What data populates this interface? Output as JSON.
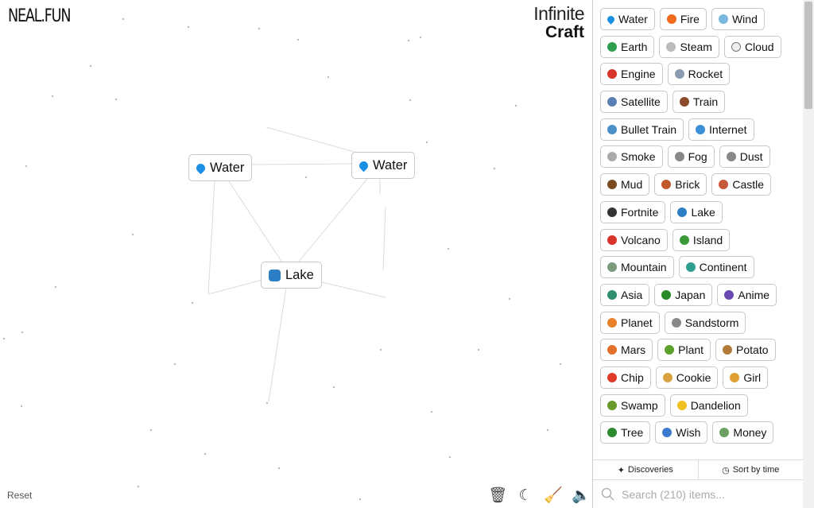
{
  "header": {
    "logo": "NEAL.FUN",
    "title_line1": "Infinite",
    "title_line2": "Craft"
  },
  "canvas": {
    "nodes": [
      {
        "label": "Water",
        "icon": "water-drop-icon",
        "color": "#1a8fe3"
      },
      {
        "label": "Water",
        "icon": "water-drop-icon",
        "color": "#1a8fe3"
      },
      {
        "label": "Lake",
        "icon": "wave-icon",
        "color": "#2c7fc4"
      }
    ],
    "reset_label": "Reset",
    "tools": [
      {
        "name": "trash-icon",
        "glyph": "🗑"
      },
      {
        "name": "moon-icon",
        "glyph": "☾"
      },
      {
        "name": "broom-icon",
        "glyph": "🧹"
      },
      {
        "name": "sound-icon",
        "glyph": "🔈"
      }
    ]
  },
  "sidebar": {
    "items": [
      {
        "label": "Water",
        "icon": "water-drop-icon",
        "color": "#1a8fe3"
      },
      {
        "label": "Fire",
        "icon": "fire-icon",
        "color": "#f26b1d"
      },
      {
        "label": "Wind",
        "icon": "wind-icon",
        "color": "#7bb8e0"
      },
      {
        "label": "Earth",
        "icon": "earth-icon",
        "color": "#2e9e4f"
      },
      {
        "label": "Steam",
        "icon": "steam-icon",
        "color": "#bbbbbb"
      },
      {
        "label": "Cloud",
        "icon": "cloud-icon",
        "color": "#eeeeee"
      },
      {
        "label": "Engine",
        "icon": "car-icon",
        "color": "#d9342b"
      },
      {
        "label": "Rocket",
        "icon": "rocket-icon",
        "color": "#8a9bb0"
      },
      {
        "label": "Satellite",
        "icon": "satellite-icon",
        "color": "#5a7fb5"
      },
      {
        "label": "Train",
        "icon": "train-icon",
        "color": "#8b4a2b"
      },
      {
        "label": "Bullet Train",
        "icon": "bullet-train-icon",
        "color": "#4a90c8"
      },
      {
        "label": "Internet",
        "icon": "globe-icon",
        "color": "#3a8fd6"
      },
      {
        "label": "Smoke",
        "icon": "smoke-icon",
        "color": "#aaaaaa"
      },
      {
        "label": "Fog",
        "icon": "fog-icon",
        "color": "#888888"
      },
      {
        "label": "Dust",
        "icon": "dust-icon",
        "color": "#888888"
      },
      {
        "label": "Mud",
        "icon": "mud-icon",
        "color": "#7a4a22"
      },
      {
        "label": "Brick",
        "icon": "brick-icon",
        "color": "#c0582a"
      },
      {
        "label": "Castle",
        "icon": "castle-icon",
        "color": "#c75a3a"
      },
      {
        "label": "Fortnite",
        "icon": "gamepad-icon",
        "color": "#333333"
      },
      {
        "label": "Lake",
        "icon": "wave-icon",
        "color": "#2c7fc4"
      },
      {
        "label": "Volcano",
        "icon": "volcano-icon",
        "color": "#d9342b"
      },
      {
        "label": "Island",
        "icon": "island-icon",
        "color": "#3a9a3a"
      },
      {
        "label": "Mountain",
        "icon": "mountain-icon",
        "color": "#7a9a7a"
      },
      {
        "label": "Continent",
        "icon": "earth-icon",
        "color": "#2e9e8f"
      },
      {
        "label": "Asia",
        "icon": "earth-icon",
        "color": "#2e8e6f"
      },
      {
        "label": "Japan",
        "icon": "japan-map-icon",
        "color": "#2a8a2a"
      },
      {
        "label": "Anime",
        "icon": "anime-icon",
        "color": "#6a4ab0"
      },
      {
        "label": "Planet",
        "icon": "planet-icon",
        "color": "#e8802a"
      },
      {
        "label": "Sandstorm",
        "icon": "tornado-icon",
        "color": "#888888"
      },
      {
        "label": "Mars",
        "icon": "planet-icon",
        "color": "#e0702a"
      },
      {
        "label": "Plant",
        "icon": "seedling-icon",
        "color": "#5aa02a"
      },
      {
        "label": "Potato",
        "icon": "potato-icon",
        "color": "#b07a3a"
      },
      {
        "label": "Chip",
        "icon": "fries-icon",
        "color": "#e03a2a"
      },
      {
        "label": "Cookie",
        "icon": "cookie-icon",
        "color": "#d9a040"
      },
      {
        "label": "Girl",
        "icon": "girl-icon",
        "color": "#e0a030"
      },
      {
        "label": "Swamp",
        "icon": "crocodile-icon",
        "color": "#6a9a2a"
      },
      {
        "label": "Dandelion",
        "icon": "flower-icon",
        "color": "#f0c020"
      },
      {
        "label": "Tree",
        "icon": "tree-icon",
        "color": "#2e8a2e"
      },
      {
        "label": "Wish",
        "icon": "shooting-star-icon",
        "color": "#3a7ad0"
      },
      {
        "label": "Money",
        "icon": "money-icon",
        "color": "#6aa060"
      }
    ],
    "tabs": [
      {
        "label": "Discoveries",
        "icon": "sparkles-icon",
        "glyph": "✦"
      },
      {
        "label": "Sort by time",
        "icon": "clock-icon",
        "glyph": "◷"
      }
    ],
    "search": {
      "placeholder": "Search (210) items..."
    }
  }
}
